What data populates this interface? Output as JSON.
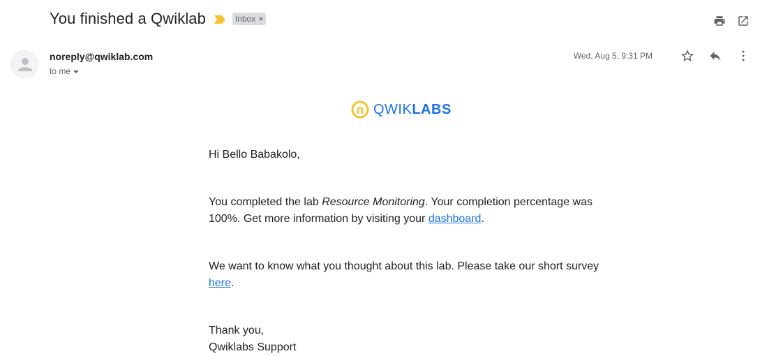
{
  "header": {
    "subject": "You finished a Qwiklab",
    "label": "Inbox",
    "label_close": "×"
  },
  "message": {
    "sender": "noreply@qwiklab.com",
    "recipient": "to me",
    "date": "Wed, Aug 5, 9:31 PM"
  },
  "logo": {
    "text_light": "QWIK",
    "text_bold": "LABS"
  },
  "body": {
    "greeting": "Hi Bello Babakolo,",
    "p1_a": "You completed the lab ",
    "p1_lab": "Resource Monitoring",
    "p1_b": ". Your completion percentage was 100%. Get more information by visiting your ",
    "p1_link": "dashboard",
    "p1_end": ".",
    "p2_a": "We want to know what you thought about this lab. Please take our short survey ",
    "p2_link": "here",
    "p2_end": ".",
    "closing_1": "Thank you,",
    "closing_2": "Qwiklabs Support"
  },
  "icons": {
    "print": "print-icon",
    "open_new": "open-in-new-window-icon",
    "star": "star-icon",
    "reply": "reply-icon",
    "more": "more-vert-icon",
    "importance": "importance-marker-icon"
  },
  "colors": {
    "link": "#1a73e8",
    "importance": "#f4c430",
    "logo_ring": "#f4c430"
  }
}
